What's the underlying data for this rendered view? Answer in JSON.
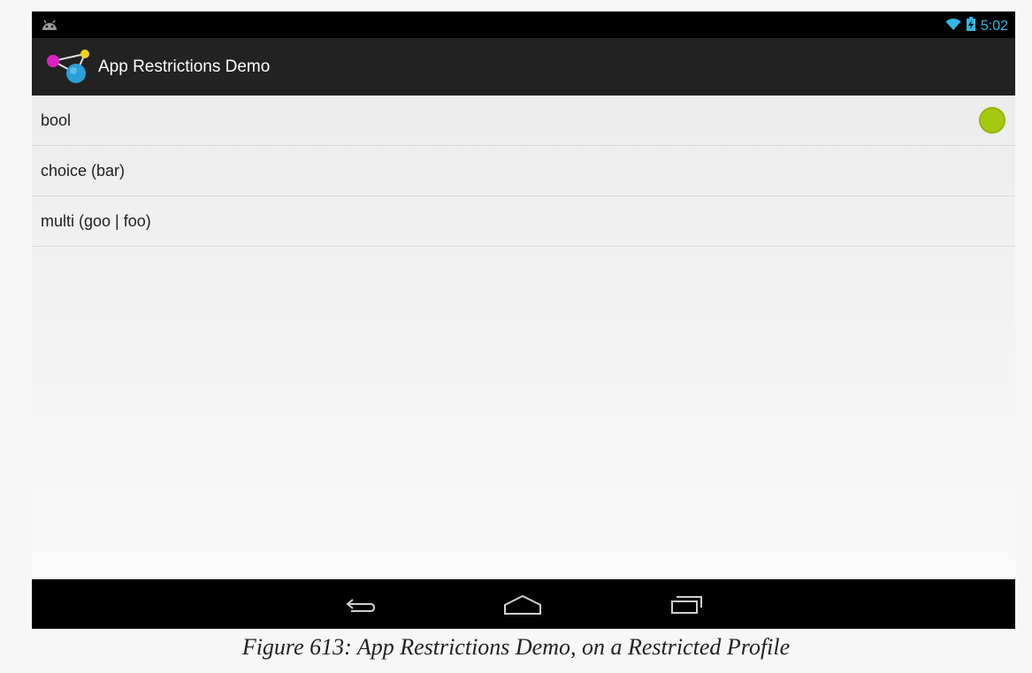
{
  "status_bar": {
    "notification_icon": "android-icon",
    "wifi_icon": "wifi-icon",
    "battery_icon": "battery-charging-icon",
    "time": "5:02"
  },
  "action_bar": {
    "app_icon": "app-restrictions-logo-icon",
    "title": "App Restrictions Demo"
  },
  "list": {
    "items": [
      {
        "label": "bool",
        "has_toggle": true,
        "toggle_on": true
      },
      {
        "label": "choice (bar)"
      },
      {
        "label": "multi (goo | foo)"
      }
    ]
  },
  "nav_bar": {
    "back_icon": "back-icon",
    "home_icon": "home-icon",
    "recents_icon": "recents-icon"
  },
  "caption": "Figure 613: App Restrictions Demo, on a Restricted Profile",
  "colors": {
    "status_accent": "#33b5e5",
    "action_bar_bg": "#222222",
    "toggle_on": "#a4c90f"
  }
}
